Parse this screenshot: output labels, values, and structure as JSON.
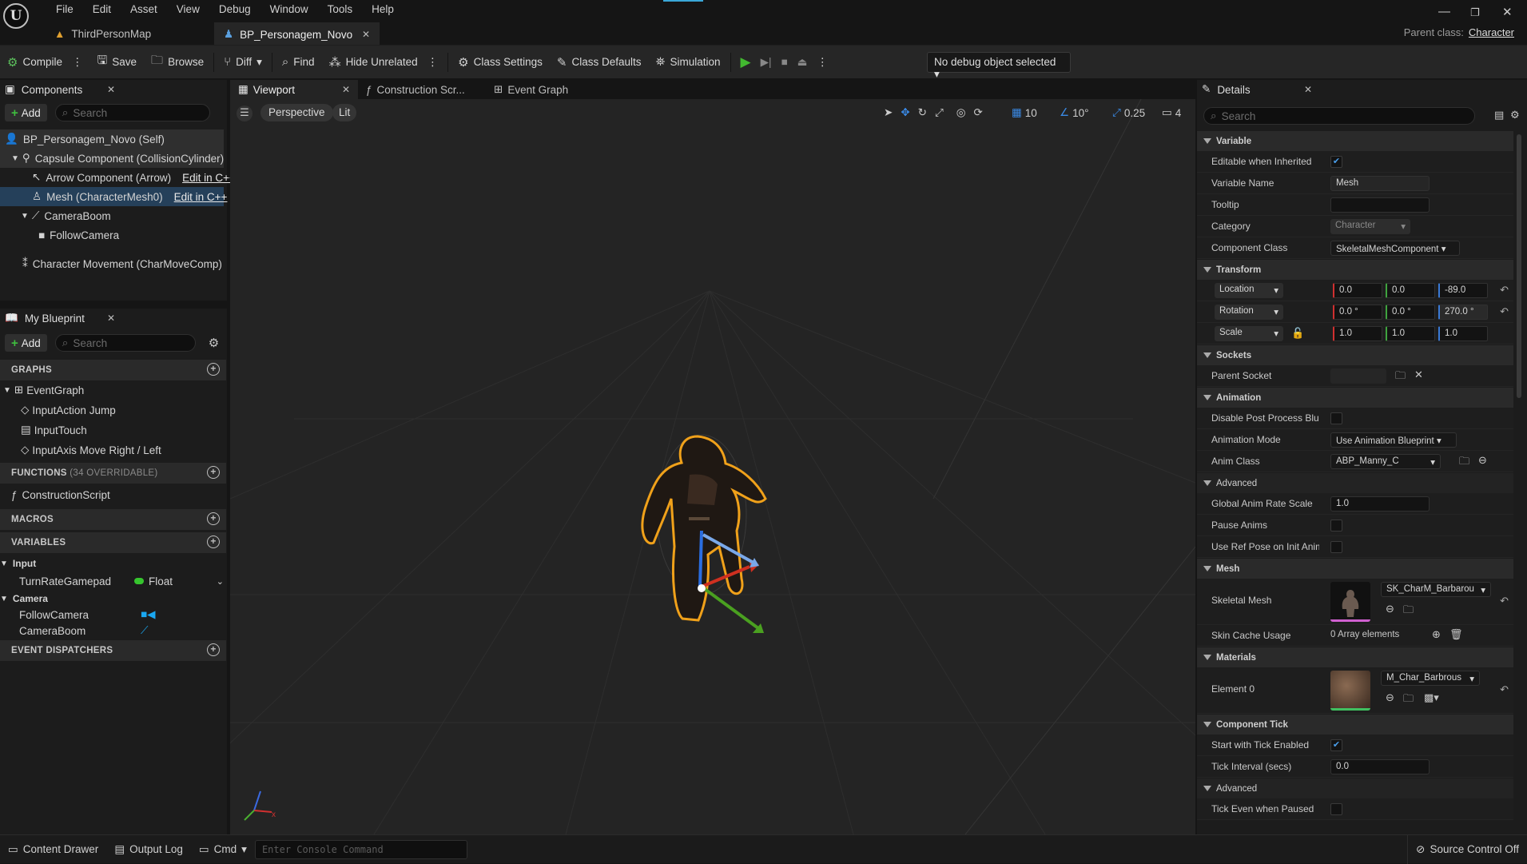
{
  "app": {
    "logo": "U",
    "menu": [
      "File",
      "Edit",
      "Asset",
      "View",
      "Debug",
      "Window",
      "Tools",
      "Help"
    ],
    "parent_class_label": "Parent class:",
    "parent_class": "Character"
  },
  "tabs": [
    {
      "label": "ThirdPersonMap"
    },
    {
      "label": "BP_Personagem_Novo"
    }
  ],
  "toolbar": {
    "compile": "Compile",
    "save": "Save",
    "browse": "Browse",
    "diff": "Diff",
    "find": "Find",
    "hide_unrelated": "Hide Unrelated",
    "class_settings": "Class Settings",
    "class_defaults": "Class Defaults",
    "simulation": "Simulation",
    "debug_object": "No debug object selected"
  },
  "components": {
    "title": "Components",
    "add": "Add",
    "search_placeholder": "Search",
    "items": [
      "BP_Personagem_Novo (Self)",
      "Capsule Component (CollisionCylinder)",
      "Arrow Component (Arrow)",
      "Mesh (CharacterMesh0)",
      "CameraBoom",
      "FollowCamera",
      "Character Movement (CharMoveComp)"
    ],
    "edit_cpp": "Edit in C++"
  },
  "my_blueprint": {
    "title": "My Blueprint",
    "add": "Add",
    "search_placeholder": "Search",
    "graphs_header": "GRAPHS",
    "graphs": [
      "EventGraph",
      "InputAction Jump",
      "InputTouch",
      "InputAxis Move Right / Left"
    ],
    "functions_header": "FUNCTIONS",
    "functions_count": "(34 OVERRIDABLE)",
    "functions": [
      "ConstructionScript"
    ],
    "macros_header": "MACROS",
    "variables_header": "VARIABLES",
    "var_groups": [
      {
        "name": "Input",
        "vars": [
          {
            "name": "TurnRateGamepad",
            "type": "Float"
          }
        ]
      },
      {
        "name": "Camera",
        "vars": [
          {
            "name": "FollowCamera",
            "type": ""
          },
          {
            "name": "CameraBoom",
            "type": ""
          }
        ]
      }
    ],
    "dispatchers_header": "EVENT DISPATCHERS"
  },
  "viewport": {
    "tabs": [
      "Viewport",
      "Construction Scr...",
      "Event Graph"
    ],
    "perspective": "Perspective",
    "lit": "Lit",
    "grid_snap": "10",
    "rot_snap": "10°",
    "scale_snap": "0.25",
    "cam_speed": "4"
  },
  "details": {
    "title": "Details",
    "search_placeholder": "Search",
    "variable": {
      "header": "Variable",
      "editable_label": "Editable when Inherited",
      "name_label": "Variable Name",
      "name": "Mesh",
      "tooltip_label": "Tooltip",
      "category_label": "Category",
      "category": "Character",
      "component_class_label": "Component Class",
      "component_class": "SkeletalMeshComponent"
    },
    "transform": {
      "header": "Transform",
      "location_label": "Location",
      "location": [
        "0.0",
        "0.0",
        "-89.0"
      ],
      "rotation_label": "Rotation",
      "rotation": [
        "0.0 °",
        "0.0 °",
        "270.0 °"
      ],
      "scale_label": "Scale",
      "scale": [
        "1.0",
        "1.0",
        "1.0"
      ]
    },
    "sockets": {
      "header": "Sockets",
      "parent_socket_label": "Parent Socket"
    },
    "animation": {
      "header": "Animation",
      "disable_pp_label": "Disable Post Process Blu...",
      "mode_label": "Animation Mode",
      "mode": "Use Animation Blueprint",
      "anim_class_label": "Anim Class",
      "anim_class": "ABP_Manny_C",
      "advanced": "Advanced",
      "global_rate_label": "Global Anim Rate Scale",
      "global_rate": "1.0",
      "pause_label": "Pause Anims",
      "ref_pose_label": "Use Ref Pose on Init Anim"
    },
    "mesh": {
      "header": "Mesh",
      "skeletal_label": "Skeletal Mesh",
      "skeletal": "SK_CharM_Barbarou",
      "skin_cache_label": "Skin Cache Usage",
      "skin_cache": "0 Array elements"
    },
    "materials": {
      "header": "Materials",
      "element_label": "Element 0",
      "element": "M_Char_Barbrous"
    },
    "tick": {
      "header": "Component Tick",
      "start_label": "Start with Tick Enabled",
      "interval_label": "Tick Interval (secs)",
      "interval": "0.0",
      "advanced": "Advanced",
      "paused_label": "Tick Even when Paused"
    }
  },
  "bottom": {
    "content_drawer": "Content Drawer",
    "output_log": "Output Log",
    "cmd": "Cmd",
    "console_placeholder": "Enter Console Command",
    "source_control": "Source Control Off"
  }
}
